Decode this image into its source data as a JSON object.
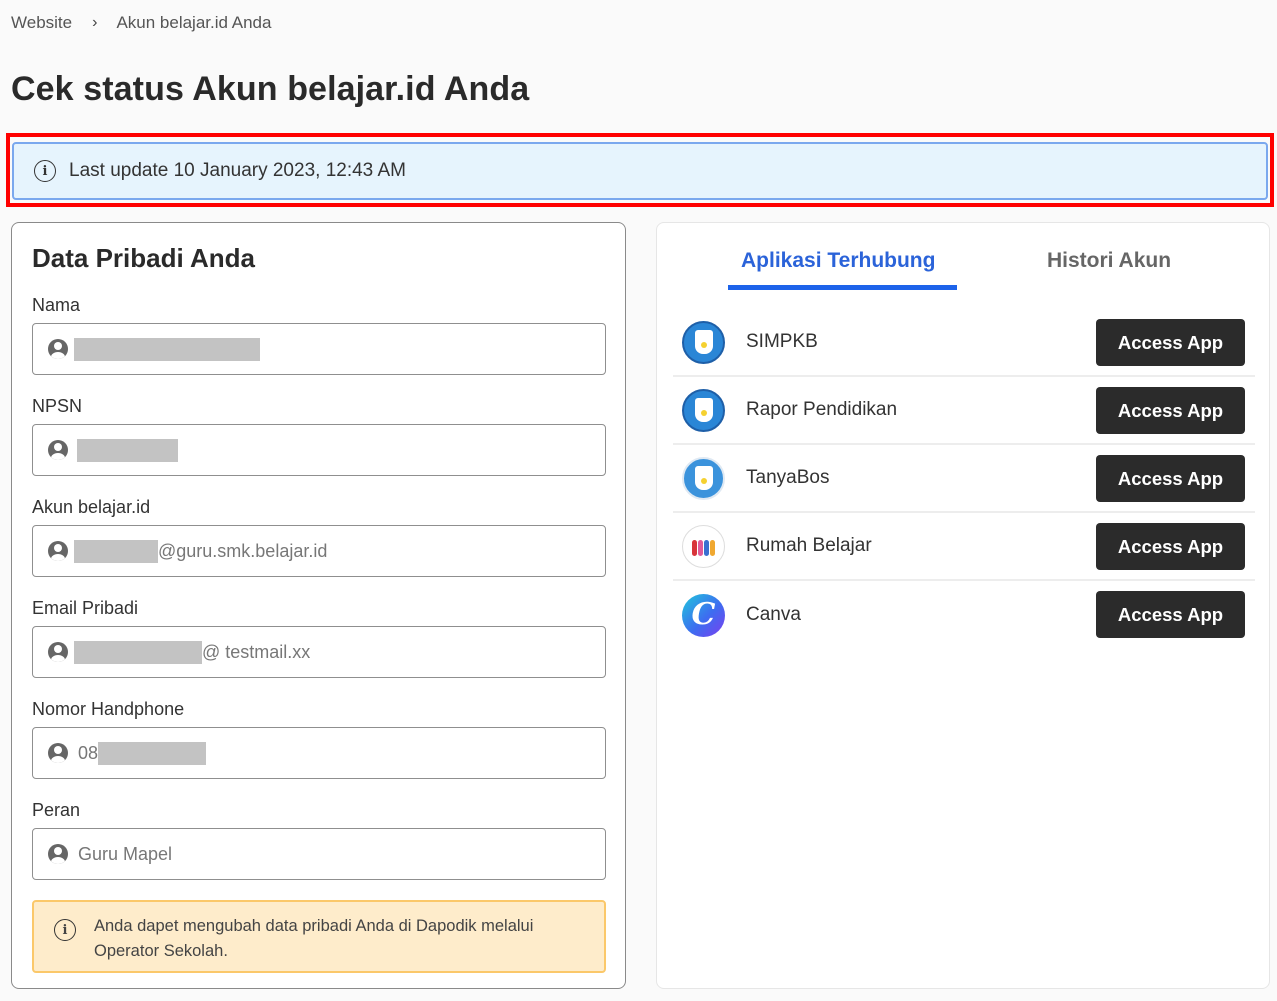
{
  "breadcrumb": {
    "items": [
      "Website",
      "Akun belajar.id Anda"
    ],
    "separator": "›"
  },
  "page_title": "Cek status Akun belajar.id Anda",
  "update_banner": {
    "icon": "info-icon",
    "text": "Last update 10 January 2023, 12:43 AM"
  },
  "personal_data": {
    "title": "Data Pribadi Anda",
    "fields": [
      {
        "label": "Nama",
        "prefix": "",
        "suffix": "",
        "redacted": true
      },
      {
        "label": "NPSN",
        "prefix": "",
        "suffix": "",
        "redacted": true
      },
      {
        "label": "Akun belajar.id",
        "prefix": "",
        "suffix": "@guru.smk.belajar.id",
        "redacted": true
      },
      {
        "label": "Email Pribadi",
        "prefix": "",
        "suffix": "@ testmail.xx",
        "redacted": true
      },
      {
        "label": "Nomor Handphone",
        "prefix": "08",
        "suffix": "",
        "redacted": true
      },
      {
        "label": "Peran",
        "prefix": "Guru Mapel",
        "suffix": "",
        "redacted": false
      }
    ],
    "notice": {
      "icon": "info-icon",
      "text": "Anda dapet mengubah data pribadi Anda di Dapodik melalui Operator Sekolah."
    }
  },
  "apps_panel": {
    "tabs": [
      {
        "label": "Aplikasi Terhubung",
        "active": true
      },
      {
        "label": "Histori Akun",
        "active": false
      }
    ],
    "accent_color": "#1d63ea",
    "apps": [
      {
        "name": "SIMPKB",
        "logo": "tut-wuri-handayani-logo",
        "button": "Access App"
      },
      {
        "name": "Rapor Pendidikan",
        "logo": "tut-wuri-handayani-logo",
        "button": "Access App"
      },
      {
        "name": "TanyaBos",
        "logo": "tut-wuri-handayani-logo",
        "button": "Access App"
      },
      {
        "name": "Rumah Belajar",
        "logo": "rumah-belajar-logo",
        "button": "Access App"
      },
      {
        "name": "Canva",
        "logo": "canva-logo",
        "logo_letter": "C",
        "button": "Access App"
      }
    ]
  }
}
